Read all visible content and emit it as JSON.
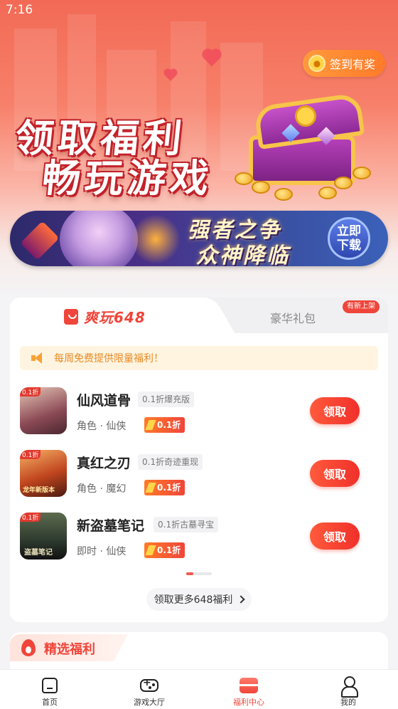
{
  "status": {
    "time": "7:16"
  },
  "hero": {
    "signin_label": "签到有奖",
    "title_line1": "领取福利",
    "title_line2": "畅玩游戏"
  },
  "banner": {
    "line1": "强者之争",
    "line2": "众神降临",
    "btn_line1": "立即",
    "btn_line2": "下载"
  },
  "tabs": {
    "active": "爽玩648",
    "other": "豪华礼包",
    "badge": "有新上架"
  },
  "notice": "每周免费提供限量福利！",
  "games": [
    {
      "name": "仙风道骨",
      "tag": "0.1折爆充版",
      "category": "角色 · 仙侠",
      "discount": "0.1折",
      "icon_tag": "0.1折",
      "button": "领取",
      "color": "#7a4a4e"
    },
    {
      "name": "真红之刃",
      "tag": "0.1折奇迹重现",
      "category": "角色 · 魔幻",
      "discount": "0.1折",
      "icon_tag": "0.1折",
      "button": "领取",
      "icon_text": "龙年新版本",
      "color": "#a8421d"
    },
    {
      "name": "新盗墓笔记",
      "tag": "0.1折古墓寻宝",
      "category": "即时 · 仙侠",
      "discount": "0.1折",
      "icon_tag": "0.1折",
      "button": "领取",
      "icon_text": "盗墓笔记",
      "color": "#2d3a2e"
    }
  ],
  "more_label": "领取更多648福利",
  "featured_label": "精选福利",
  "nav": [
    {
      "label": "首页",
      "icon": "home-icon"
    },
    {
      "label": "游戏大厅",
      "icon": "gamepad-icon"
    },
    {
      "label": "福利中心",
      "icon": "gift-icon",
      "active": true
    },
    {
      "label": "我的",
      "icon": "user-icon"
    }
  ],
  "colors": {
    "accent": "#f0453a",
    "notice_text": "#e98a25"
  }
}
